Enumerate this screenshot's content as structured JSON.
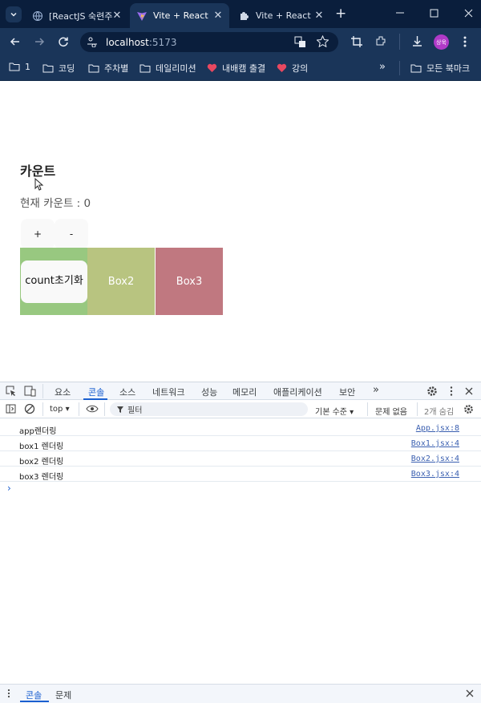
{
  "browser": {
    "tabs": [
      {
        "label": "[ReactJS 숙련주"
      },
      {
        "label": "Vite + React"
      },
      {
        "label": "Vite + React"
      }
    ],
    "url_host": "localhost",
    "url_port": ":5173",
    "profile_label": "상욱",
    "bookmarks": [
      "1",
      "코딩",
      "주차별",
      "데일리미션",
      "내배캠 출결",
      "강의"
    ],
    "all_bookmarks": "모든 북마크",
    "more_bookmarks": "»"
  },
  "page": {
    "title": "카운트",
    "count_text": "현재 카운트 : 0",
    "plus_label": "+",
    "minus_label": "-",
    "reset_label": "count초기화",
    "box2_label": "Box2",
    "box3_label": "Box3"
  },
  "devtools": {
    "tabs": [
      "요소",
      "콘솔",
      "소스",
      "네트워크",
      "성능",
      "메모리",
      "애플리케이션",
      "보안",
      "»"
    ],
    "active_tab": "콘솔",
    "context": "top ▾",
    "filter_placeholder": "필터",
    "level": "기본 수준 ▾",
    "issues": "문제 없음",
    "hidden": "2개 숨김",
    "logs": [
      {
        "message": "app렌더링",
        "source": "App.jsx:8"
      },
      {
        "message": "box1 렌더링",
        "source": "Box1.jsx:4"
      },
      {
        "message": "box2 렌더링",
        "source": "Box2.jsx:4"
      },
      {
        "message": "box3 렌더링",
        "source": "Box3.jsx:4"
      }
    ],
    "prompt": "›",
    "drawer_tabs": [
      "콘솔",
      "문제"
    ]
  },
  "colors": {
    "box1": "#98c880",
    "box2": "#b8c480",
    "box3": "#c07880",
    "chrome_dark": "#0a1e3c",
    "chrome_toolbar": "#1a3559"
  }
}
